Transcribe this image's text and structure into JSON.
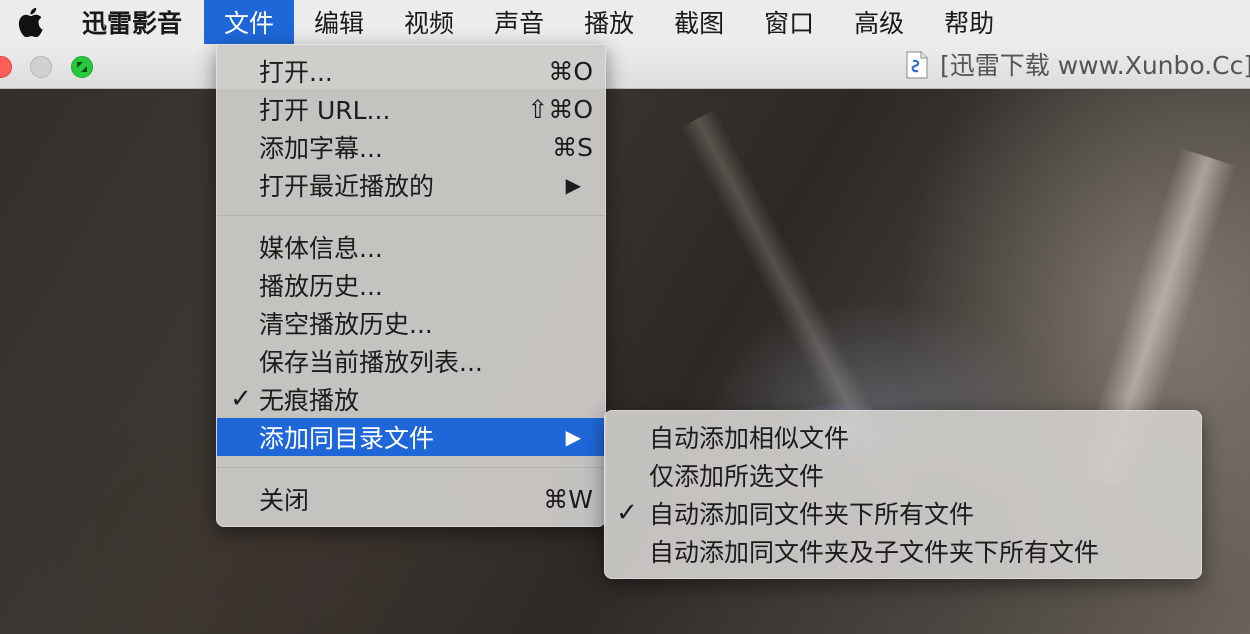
{
  "menubar": {
    "apple_icon": "apple-logo",
    "app_name": "迅雷影音",
    "menus": [
      "文件",
      "编辑",
      "视频",
      "声音",
      "播放",
      "截图",
      "窗口",
      "高级",
      "帮助"
    ],
    "active_menu": "文件"
  },
  "window": {
    "title": "[迅雷下载 www.Xunbo.Cc]",
    "doc_icon": "document-icon",
    "traffic_lights": [
      "close",
      "minimize",
      "zoom"
    ]
  },
  "file_menu": {
    "items": [
      {
        "label": "打开...",
        "shortcut": "⌘O"
      },
      {
        "label": "打开 URL...",
        "shortcut": "⇧⌘O"
      },
      {
        "label": "添加字幕...",
        "shortcut": "⌘S"
      },
      {
        "label": "打开最近播放的",
        "submenu_arrow": "▶"
      },
      {
        "label": "媒体信息..."
      },
      {
        "label": "播放历史..."
      },
      {
        "label": "清空播放历史..."
      },
      {
        "label": "保存当前播放列表..."
      },
      {
        "label": "无痕播放",
        "check": "✓"
      },
      {
        "label": "添加同目录文件",
        "submenu_arrow": "▶"
      },
      {
        "label": "关闭",
        "shortcut": "⌘W"
      }
    ]
  },
  "submenu": {
    "items": [
      {
        "label": "自动添加相似文件"
      },
      {
        "label": "仅添加所选文件"
      },
      {
        "label": "自动添加同文件夹下所有文件",
        "check": "✓"
      },
      {
        "label": "自动添加同文件夹及子文件夹下所有文件"
      }
    ]
  },
  "colors": {
    "highlight": "#1f67d8",
    "menubar_bg": "#ececec",
    "menu_bg": "#cecbc9"
  }
}
